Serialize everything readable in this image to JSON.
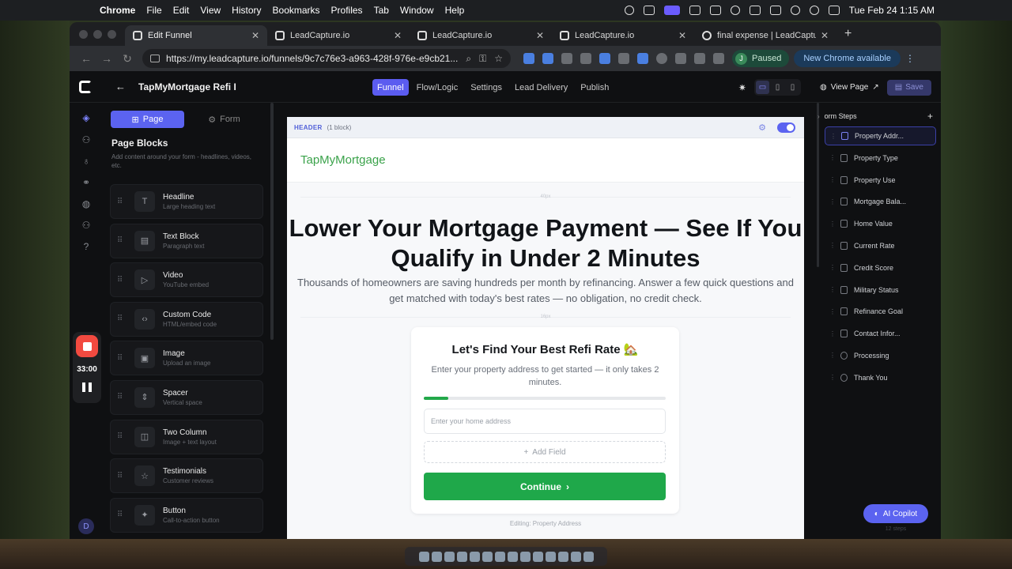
{
  "menubar": {
    "app": "Chrome",
    "items": [
      "File",
      "Edit",
      "View",
      "History",
      "Bookmarks",
      "Profiles",
      "Tab",
      "Window",
      "Help"
    ],
    "clock": "Tue Feb 24  1:15 AM"
  },
  "browser": {
    "tabs": [
      {
        "title": "Edit Funnel",
        "active": true
      },
      {
        "title": "LeadCapture.io",
        "active": false
      },
      {
        "title": "LeadCapture.io",
        "active": false
      },
      {
        "title": "LeadCapture.io",
        "active": false
      },
      {
        "title": "final expense | LeadCapture.io",
        "active": false
      }
    ],
    "url": "https://my.leadcapture.io/funnels/9c7c76e3-a963-428f-976e-e9cb21...",
    "profile_initial": "J",
    "profile_status": "Paused",
    "update_label": "New Chrome available"
  },
  "app": {
    "funnel_name": "TapMyMortgage Refi I",
    "nav_tabs": [
      "Funnel",
      "Flow/Logic",
      "Settings",
      "Lead Delivery",
      "Publish"
    ],
    "view_page_label": "View Page",
    "save_label": "Save",
    "recording_time": "33:00",
    "user_initial": "D"
  },
  "left_panel": {
    "tabs": [
      "Page",
      "Form"
    ],
    "title": "Page Blocks",
    "description": "Add content around your form - headlines, videos, etc.",
    "blocks": [
      {
        "name": "Headline",
        "desc": "Large heading text",
        "icon": "T"
      },
      {
        "name": "Text Block",
        "desc": "Paragraph text",
        "icon": "▤"
      },
      {
        "name": "Video",
        "desc": "YouTube embed",
        "icon": "▷"
      },
      {
        "name": "Custom Code",
        "desc": "HTML/embed code",
        "icon": "‹›"
      },
      {
        "name": "Image",
        "desc": "Upload an image",
        "icon": "▣"
      },
      {
        "name": "Spacer",
        "desc": "Vertical space",
        "icon": "⇕"
      },
      {
        "name": "Two Column",
        "desc": "Image + text layout",
        "icon": "◫"
      },
      {
        "name": "Testimonials",
        "desc": "Customer reviews",
        "icon": "☆"
      },
      {
        "name": "Button",
        "desc": "Call-to-action button",
        "icon": "✦"
      }
    ]
  },
  "canvas": {
    "header_label": "HEADER",
    "header_count": "(1 block)",
    "brand": "TapMyMortgage",
    "spacer_top_label": "40px",
    "spacer_mid_label": "16px",
    "headline": "Lower Your Mortgage Payment — See If You Qualify in Under 2 Minutes",
    "subheadline": "Thousands of homeowners are saving hundreds per month by refinancing. Answer a few quick questions and get matched with today's best rates — no obligation, no credit check.",
    "card": {
      "title": "Let's Find Your Best Refi Rate 🏡",
      "description": "Enter your property address to get started — it only takes 2 minutes.",
      "progress": 0.1,
      "address_placeholder": "Enter your home address",
      "add_field_label": "Add Field",
      "continue_label": "Continue"
    },
    "editing_label": "Editing: Property Address"
  },
  "right_panel": {
    "title": "orm Steps",
    "steps": [
      {
        "label": "Property Addr...",
        "active": true,
        "icon": "doc"
      },
      {
        "label": "Property Type",
        "active": false,
        "icon": "doc"
      },
      {
        "label": "Property Use",
        "active": false,
        "icon": "doc"
      },
      {
        "label": "Mortgage Bala...",
        "active": false,
        "icon": "doc"
      },
      {
        "label": "Home Value",
        "active": false,
        "icon": "doc"
      },
      {
        "label": "Current Rate",
        "active": false,
        "icon": "doc"
      },
      {
        "label": "Credit Score",
        "active": false,
        "icon": "doc"
      },
      {
        "label": "Military Status",
        "active": false,
        "icon": "doc"
      },
      {
        "label": "Refinance Goal",
        "active": false,
        "icon": "doc"
      },
      {
        "label": "Contact Infor...",
        "active": false,
        "icon": "doc"
      },
      {
        "label": "Processing",
        "active": false,
        "icon": "clock"
      },
      {
        "label": "Thank You",
        "active": false,
        "icon": "check"
      }
    ],
    "ai_copilot_label": "AI Copilot",
    "steps_count": "12 steps"
  },
  "colors": {
    "accent": "#5b63f0",
    "brand_green": "#3aa24a",
    "cta_green": "#1fa84a",
    "record_red": "#f24a40"
  }
}
